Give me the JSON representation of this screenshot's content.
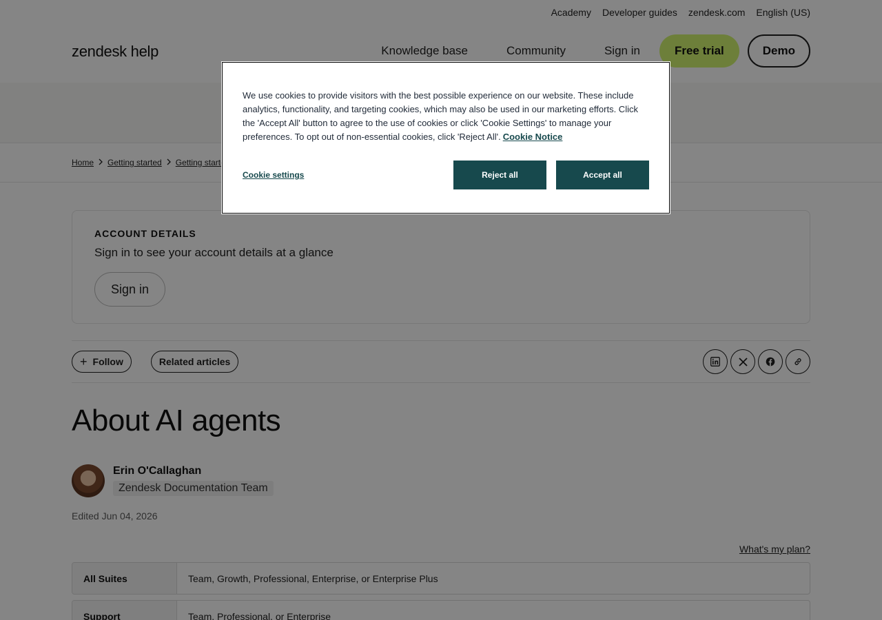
{
  "utility_nav": {
    "items": [
      "Academy",
      "Developer guides",
      "zendesk.com",
      "English (US)"
    ]
  },
  "header": {
    "logo": "zendesk help",
    "nav": [
      "Knowledge base",
      "Community",
      "Sign in"
    ],
    "free_trial_label": "Free trial",
    "demo_label": "Demo"
  },
  "breadcrumbs": [
    "Home",
    "Getting started",
    "Getting started"
  ],
  "account": {
    "title": "ACCOUNT DETAILS",
    "subtitle": "Sign in to see your account details at a glance",
    "sign_in_label": "Sign in"
  },
  "actions": {
    "follow_label": "Follow",
    "related_label": "Related articles",
    "share": [
      "linkedin-icon",
      "x-icon",
      "facebook-icon",
      "link-icon"
    ]
  },
  "article": {
    "title": "About AI agents",
    "author_name": "Erin O'Callaghan",
    "author_team": "Zendesk Documentation Team",
    "edited": "Edited Jun 04, 2026",
    "whats_my_plan": "What's my plan?",
    "plans": [
      {
        "label": "All Suites",
        "value": "Team, Growth, Professional, Enterprise, or Enterprise Plus"
      },
      {
        "label": "Support",
        "value": "Team, Professional, or Enterprise"
      }
    ]
  },
  "cookie": {
    "text": "We use cookies to provide visitors with the best possible experience on our website. These include analytics, functionality, and targeting cookies, which may also be used in our marketing efforts. Click the 'Accept All' button to agree to the use of cookies or click 'Cookie Settings' to manage your preferences. To opt out of non-essential cookies, click 'Reject All'.",
    "notice_link": "Cookie Notice",
    "settings_label": "Cookie settings",
    "reject_label": "Reject all",
    "accept_label": "Accept all",
    "accent_color": "#17494d"
  },
  "colors": {
    "free_trial_bg": "#d1f470"
  }
}
